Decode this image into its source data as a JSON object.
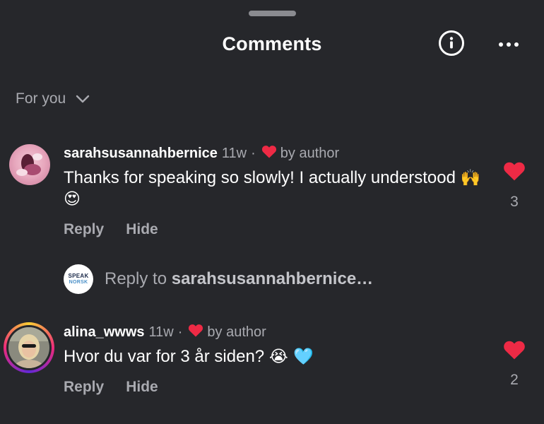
{
  "header": {
    "title": "Comments"
  },
  "filter": {
    "label": "For you"
  },
  "comments": [
    {
      "username": "sarahsusannahbernice",
      "age": "11w",
      "dot": "·",
      "by_author": "by author",
      "text": "Thanks for speaking so slowly! I actually understood",
      "emojis": "🙌 😍",
      "reply_label": "Reply",
      "hide_label": "Hide",
      "likes": "3"
    },
    {
      "username": "alina_wwws",
      "age": "11w",
      "dot": "·",
      "by_author": "by author",
      "text": "Hvor du var for 3 år siden?",
      "emojis": "😭 🩵",
      "reply_label": "Reply",
      "hide_label": "Hide",
      "likes": "2"
    }
  ],
  "reply_box": {
    "logo_line1": "SPEAK",
    "logo_line2": "NORSK",
    "prefix": "Reply to",
    "target": "sarahsusannahbernice…"
  },
  "colors": {
    "background": "#26272b",
    "like": "#ee2a45",
    "muted": "#a9aab0"
  }
}
